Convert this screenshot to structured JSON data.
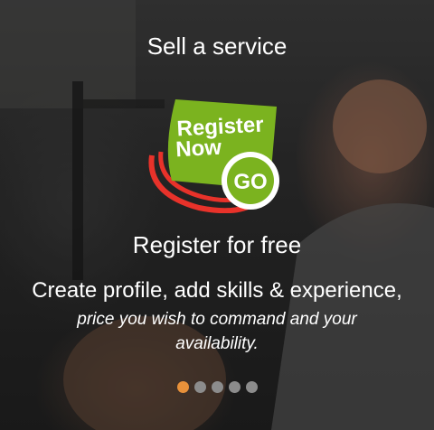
{
  "slide": {
    "title": "Sell a service",
    "badge": {
      "line1": "Register",
      "line2": "Now",
      "go": "GO",
      "green": "#7bb31f",
      "red": "#e8322a"
    },
    "subtitle": "Register for free",
    "lead": "Create profile, add skills & experience,",
    "description": "price you wish to command and your availability."
  },
  "pagination": {
    "active_index": 0,
    "active_color": "#e8913a",
    "inactive_color": "#8c8c8c",
    "dots": [
      "1",
      "2",
      "3",
      "4",
      "5",
      "6"
    ]
  }
}
